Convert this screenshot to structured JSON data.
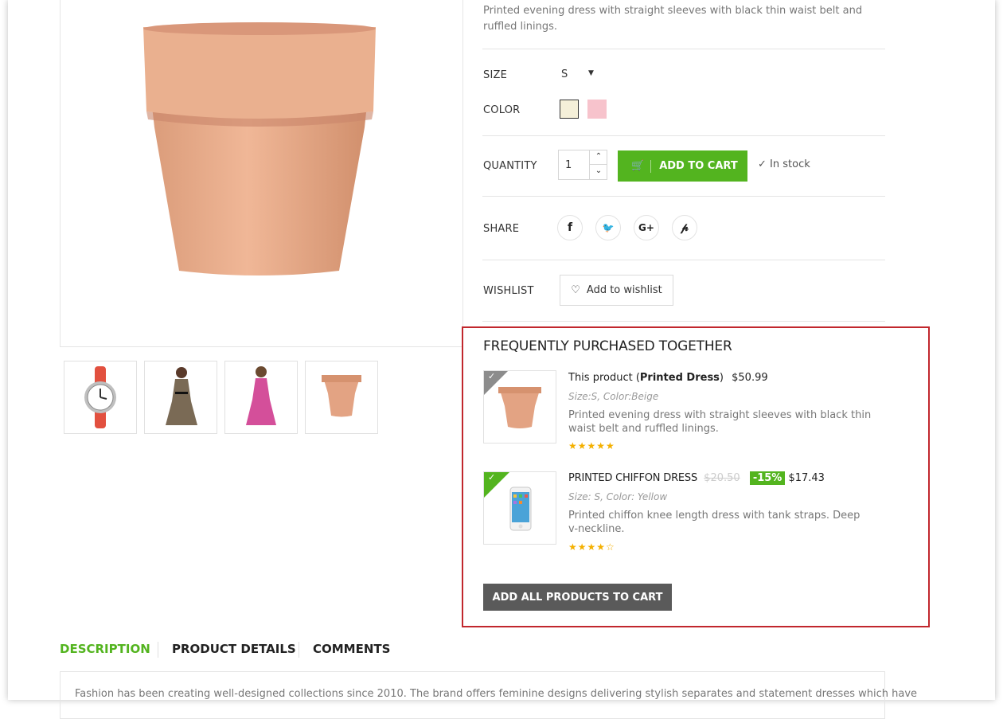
{
  "product": {
    "short_description": "Printed evening dress with straight sleeves with black thin waist belt and ruffled linings."
  },
  "options": {
    "size_label": "SIZE",
    "size_value": "S",
    "color_label": "COLOR",
    "color_swatches": [
      "#f5f0d9",
      "#f7c3cc"
    ]
  },
  "cart": {
    "quantity_label": "QUANTITY",
    "quantity_value": "1",
    "add_to_cart_label": "ADD TO CART",
    "stock_status": "In stock",
    "accent_color": "#53b41f"
  },
  "share": {
    "label": "SHARE",
    "icons": [
      "facebook-icon",
      "twitter-icon",
      "google-plus-icon",
      "pinterest-icon"
    ],
    "glyphs": [
      "f",
      "🐦",
      "G+",
      "𝓅"
    ]
  },
  "wishlist": {
    "label": "WISHLIST",
    "button_label": "Add to wishlist"
  },
  "fpt": {
    "title": "FREQUENTLY PURCHASED TOGETHER",
    "items": [
      {
        "prefix": "This product (",
        "name": "Printed Dress",
        "suffix": ")",
        "price": "$50.99",
        "attributes": "Size:S, Color:Beige",
        "description": "Printed evening dress with straight sleeves with black thin waist belt and ruffled linings.",
        "rating": "★★★★★"
      },
      {
        "name": "PRINTED CHIFFON DRESS",
        "old_price": "$20.50",
        "discount": "-15%",
        "price": "$17.43",
        "attributes": "Size: S, Color: Yellow",
        "description": "Printed chiffon knee length dress with tank straps. Deep v-neckline.",
        "rating": "★★★★☆"
      }
    ],
    "add_all_label": "ADD ALL PRODUCTS TO CART",
    "border_color": "#c1272d"
  },
  "tabs": [
    {
      "label": "DESCRIPTION"
    },
    {
      "label": "PRODUCT DETAILS"
    },
    {
      "label": "COMMENTS"
    }
  ],
  "description_text": "Fashion has been creating well-designed collections since 2010. The brand offers feminine designs delivering stylish separates and statement dresses which have"
}
